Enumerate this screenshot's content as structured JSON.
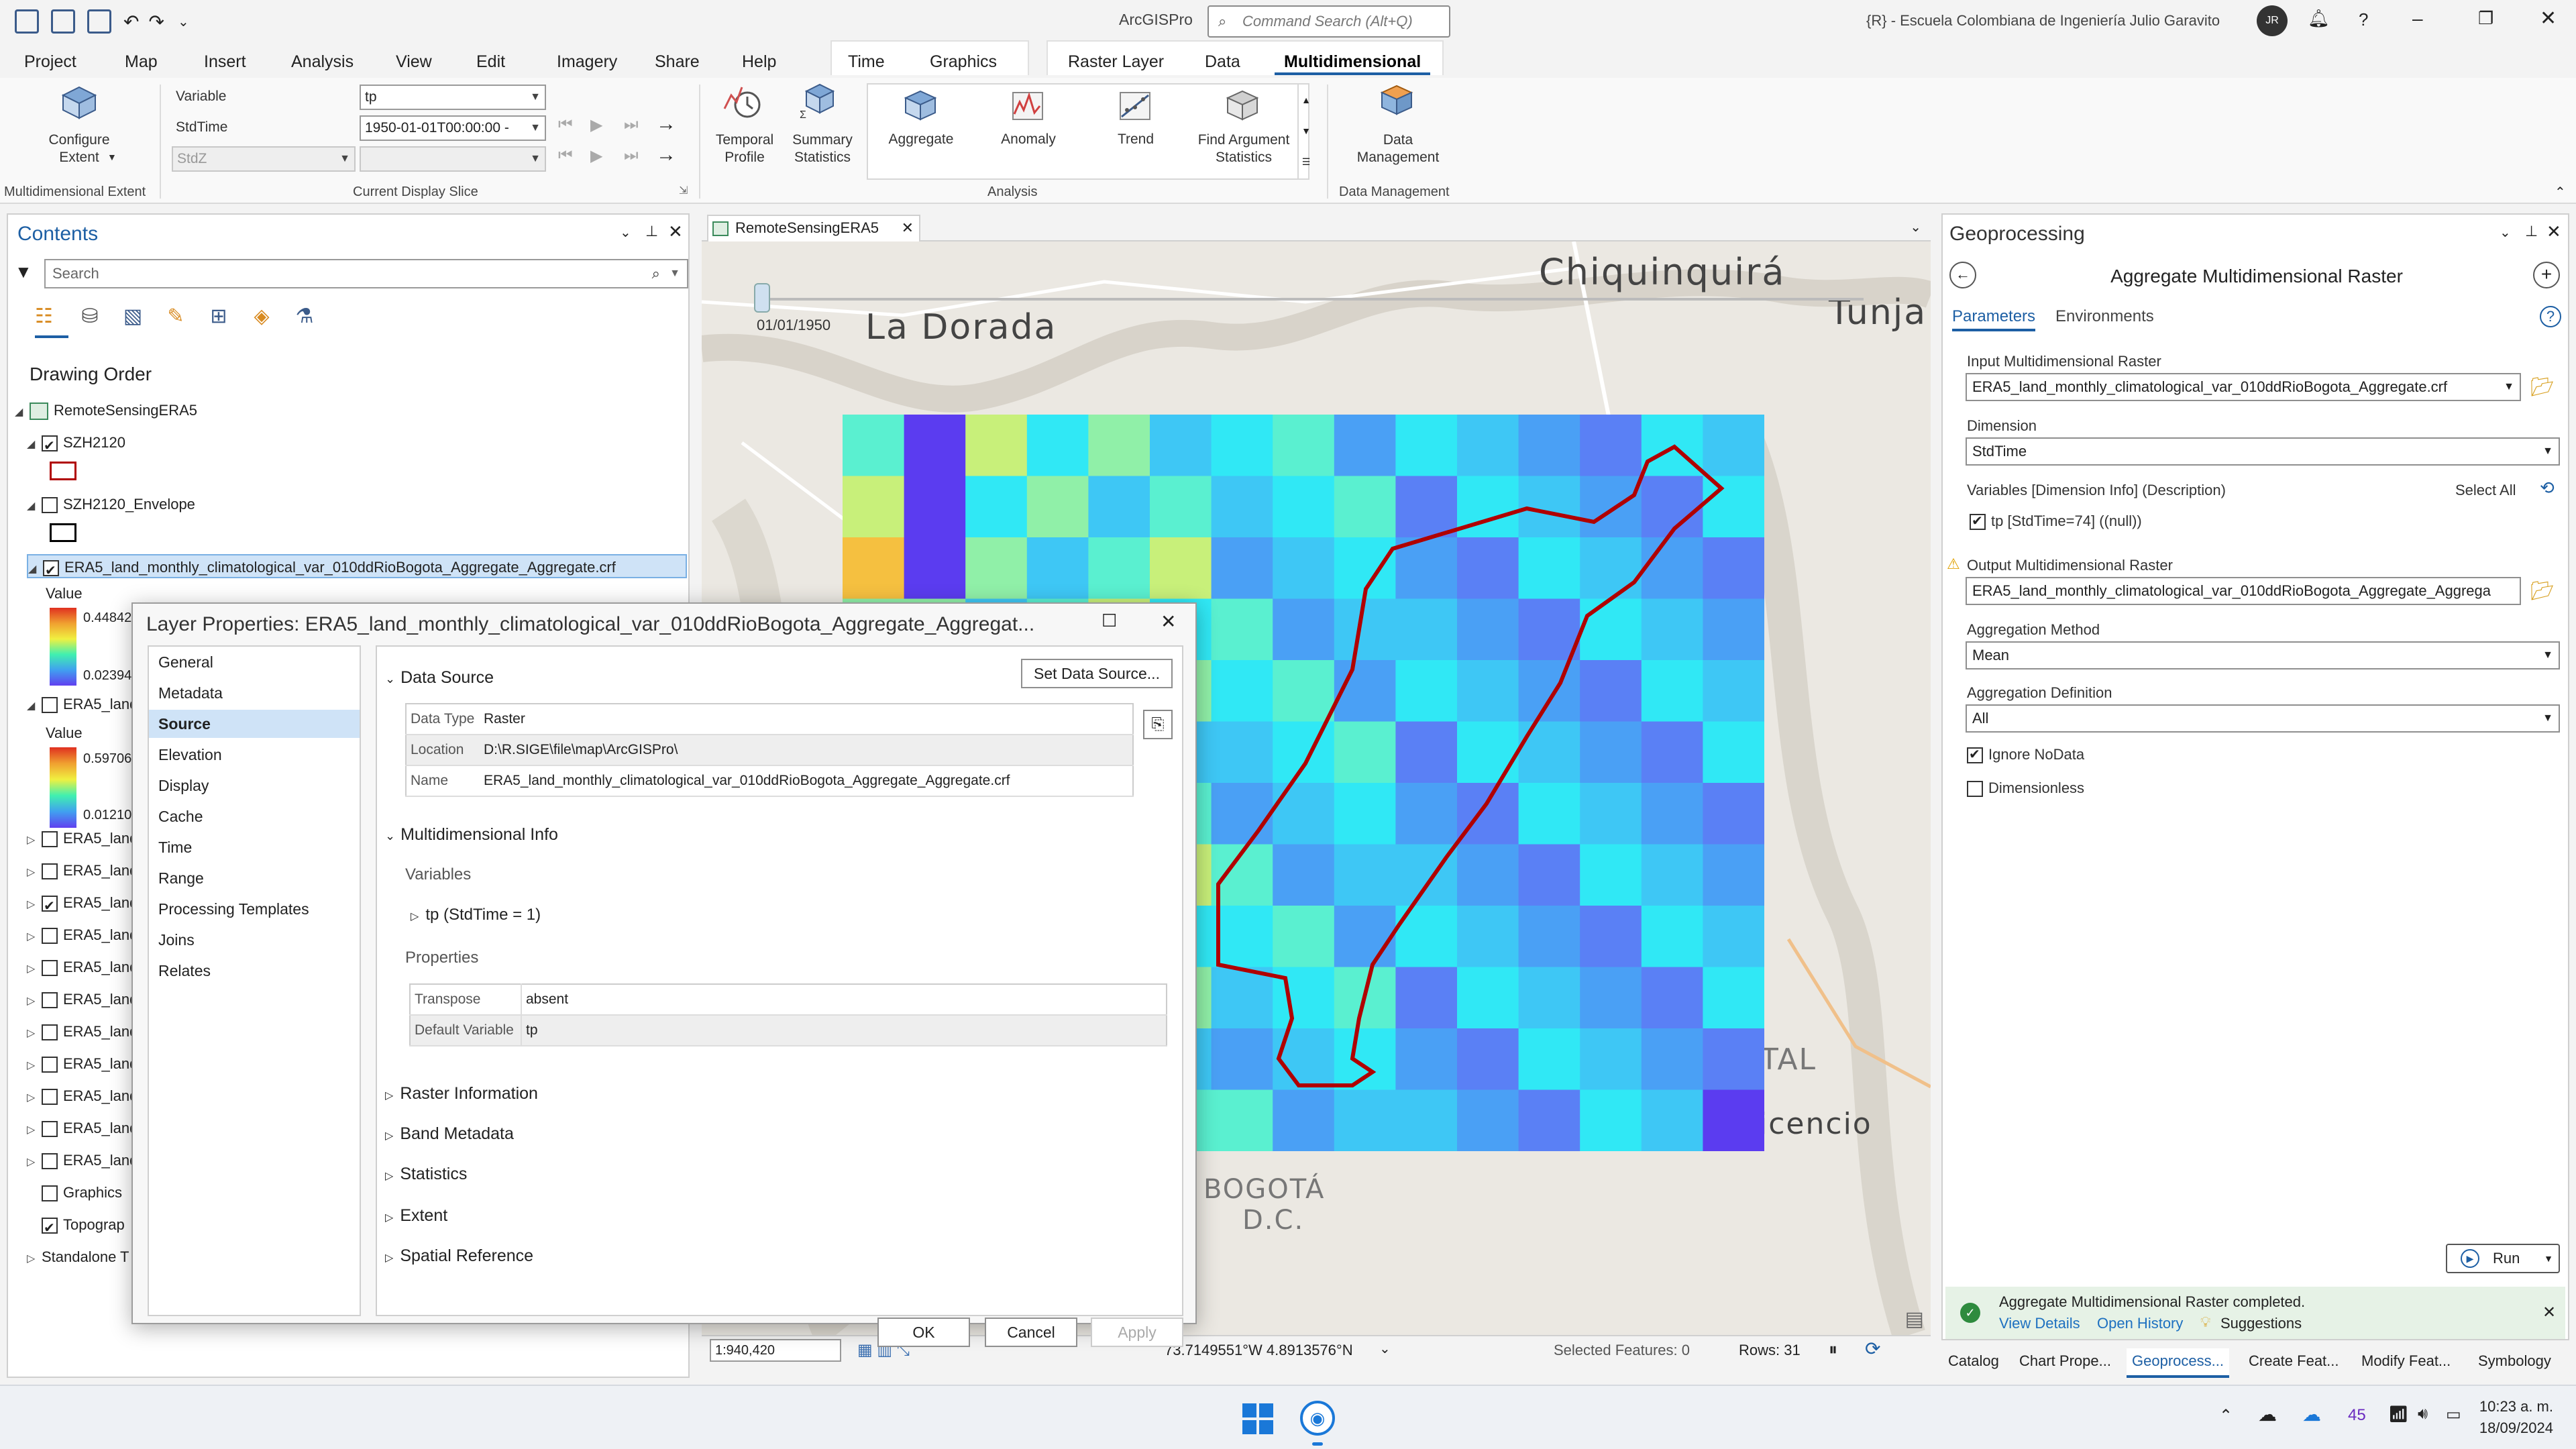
{
  "app": {
    "title": "ArcGISPro",
    "command_search_placeholder": "Command Search (Alt+Q)",
    "org": "{R} - Escuela Colombiana de Ingeniería Julio Garavito",
    "avatar": "JR"
  },
  "menu": {
    "tabs": [
      "Project",
      "Map",
      "Insert",
      "Analysis",
      "View",
      "Edit",
      "Imagery",
      "Share",
      "Help"
    ],
    "context_tabs": [
      "Time",
      "Graphics",
      "Raster Layer",
      "Data",
      "Multidimensional"
    ],
    "active_tab": "Multidimensional"
  },
  "ribbon": {
    "configure_extent": "Configure Extent",
    "group_md_extent": "Multidimensional Extent",
    "variable_label": "Variable",
    "variable_value": "tp",
    "stdtime_label": "StdTime",
    "stdtime_value": "1950-01-01T00:00:00 -",
    "stdz_value": "StdZ",
    "group_slice": "Current Display Slice",
    "temporal_profile": "Temporal Profile",
    "summary_statistics": "Summary Statistics",
    "tools": [
      "Aggregate",
      "Anomaly",
      "Trend",
      "Find Argument Statistics"
    ],
    "group_analysis": "Analysis",
    "data_management": "Data Management",
    "group_data_mgmt": "Data Management"
  },
  "contents": {
    "title": "Contents",
    "search_placeholder": "Search",
    "drawing_order": "Drawing Order",
    "map_name": "RemoteSensingERA5",
    "layers": [
      {
        "name": "SZH2120",
        "checked": true
      },
      {
        "name": "SZH2120_Envelope",
        "checked": false
      },
      {
        "name": "ERA5_land_monthly_climatological_var_010ddRioBogota_Aggregate_Aggregate.crf",
        "checked": true
      }
    ],
    "value_label": "Value",
    "legend1": {
      "max": "0.44842",
      "min": "0.02394"
    },
    "layer4": "ERA5_land",
    "legend2": {
      "max": "0.59706",
      "min": "0.01210"
    },
    "extra_layers": [
      {
        "name": "ERA5_land",
        "checked": false
      },
      {
        "name": "ERA5_land",
        "checked": false
      },
      {
        "name": "ERA5_land",
        "checked": true
      },
      {
        "name": "ERA5_land",
        "checked": false
      },
      {
        "name": "ERA5_land",
        "checked": false
      },
      {
        "name": "ERA5_land",
        "checked": false
      },
      {
        "name": "ERA5_land",
        "checked": false
      },
      {
        "name": "ERA5_land",
        "checked": false
      },
      {
        "name": "ERA5_land",
        "checked": false
      },
      {
        "name": "ERA5_land",
        "checked": false
      },
      {
        "name": "ERA5_land",
        "checked": false
      }
    ],
    "graphics": "Graphics",
    "topographic": "Topograp",
    "standalone": "Standalone T"
  },
  "map": {
    "tab": "RemoteSensingERA5",
    "time_label": "01/01/1950",
    "places": [
      "Chiquinquirá",
      "Tunja",
      "La Dorada",
      "BOGOTÁ",
      "D.C.",
      "icencio",
      "TAL"
    ],
    "coords": "73.7149551°W 4.8913576°N",
    "selected_features": "Selected Features: 0",
    "rows": "Rows: 31",
    "scale": "1:940,420"
  },
  "dialog": {
    "title": "Layer Properties: ERA5_land_monthly_climatological_var_010ddRioBogota_Aggregate_Aggregat...",
    "nav": [
      "General",
      "Metadata",
      "Source",
      "Elevation",
      "Display",
      "Cache",
      "Time",
      "Range",
      "Processing Templates",
      "Joins",
      "Relates"
    ],
    "active_nav": "Source",
    "data_source": "Data Source",
    "set_data_source": "Set Data Source...",
    "rows": [
      {
        "k": "Data Type",
        "v": "Raster"
      },
      {
        "k": "Location",
        "v": "D:\\R.SIGE\\file\\map\\ArcGISPro\\"
      },
      {
        "k": "Name",
        "v": "ERA5_land_monthly_climatological_var_010ddRioBogota_Aggregate_Aggregate.crf"
      }
    ],
    "md_info": "Multidimensional Info",
    "variables": "Variables",
    "var_item": "tp (StdTime = 1)",
    "properties": "Properties",
    "props": [
      {
        "k": "Transpose",
        "v": "absent"
      },
      {
        "k": "Default Variable",
        "v": "tp"
      }
    ],
    "sections": [
      "Raster Information",
      "Band Metadata",
      "Statistics",
      "Extent",
      "Spatial Reference"
    ],
    "ok": "OK",
    "cancel": "Cancel",
    "apply": "Apply"
  },
  "gp": {
    "title": "Geoprocessing",
    "tool": "Aggregate Multidimensional Raster",
    "tabs": [
      "Parameters",
      "Environments"
    ],
    "input_label": "Input Multidimensional Raster",
    "input_value": "ERA5_land_monthly_climatological_var_010ddRioBogota_Aggregate.crf",
    "dimension_label": "Dimension",
    "dimension_value": "StdTime",
    "variables_label": "Variables [Dimension Info] (Description)",
    "select_all": "Select All",
    "var_item": "tp [StdTime=74] ((null))",
    "output_label": "Output Multidimensional Raster",
    "output_value": "ERA5_land_monthly_climatological_var_010ddRioBogota_Aggregate_Aggrega",
    "method_label": "Aggregation Method",
    "method_value": "Mean",
    "definition_label": "Aggregation Definition",
    "definition_value": "All",
    "ignore_nodata": "Ignore NoData",
    "dimensionless": "Dimensionless",
    "run": "Run",
    "status": "Aggregate Multidimensional Raster completed.",
    "view_details": "View Details",
    "open_history": "Open History",
    "suggestions": "Suggestions"
  },
  "bottom_tabs": [
    "Catalog",
    "Chart Prope...",
    "Geoprocess...",
    "Create Feat...",
    "Modify Feat...",
    "Symbology"
  ],
  "taskbar": {
    "temp": "45",
    "time": "10:23 a. m.",
    "date": "18/09/2024"
  }
}
